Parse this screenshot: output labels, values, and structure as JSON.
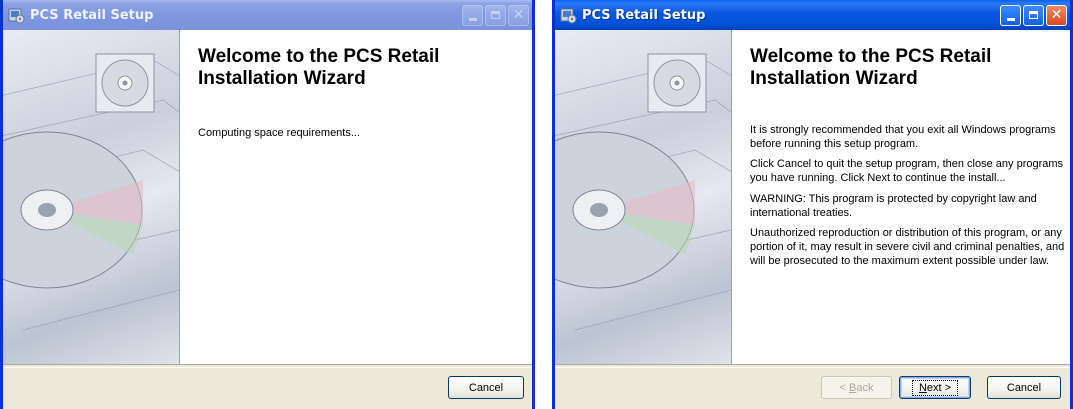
{
  "colors": {
    "xp_active_title": "#0a56e0",
    "xp_inactive_title": "#8ba2e5",
    "dialog_face": "#ece9d8"
  },
  "windows": [
    {
      "title": "PCS Retail Setup",
      "state": "inactive",
      "heading": "Welcome to the PCS Retail Installation Wizard",
      "status": "Computing space requirements...",
      "buttons": {
        "cancel": "Cancel"
      },
      "controls": {
        "minimize": "minimize-icon",
        "maximize": "maximize-icon",
        "close": "close-icon"
      }
    },
    {
      "title": "PCS Retail Setup",
      "state": "active",
      "heading": "Welcome to the PCS Retail Installation Wizard",
      "paragraphs": [
        "It is strongly recommended that you exit all Windows programs before running this setup program.",
        "Click Cancel to quit the setup program, then close any programs you have running.  Click Next to continue the install...",
        "WARNING: This program is protected by copyright law and international treaties.",
        "Unauthorized reproduction or distribution of this program, or any portion of it, may result in severe civil and criminal penalties, and will be prosecuted to the maximum extent possible under law."
      ],
      "buttons": {
        "back_prefix": "< ",
        "back_mnemonic": "B",
        "back_rest": "ack",
        "next_mnemonic": "N",
        "next_rest": "ext >",
        "cancel": "Cancel"
      },
      "controls": {
        "minimize": "minimize-icon",
        "maximize": "maximize-icon",
        "close": "close-icon"
      }
    }
  ]
}
